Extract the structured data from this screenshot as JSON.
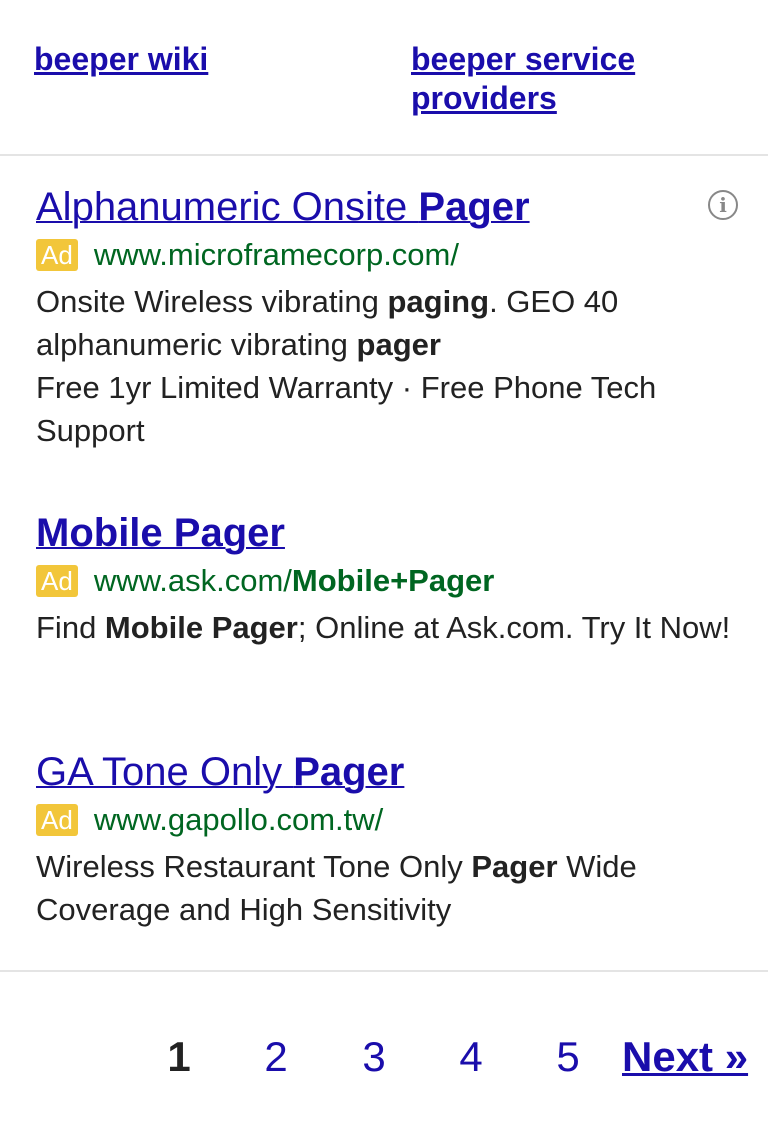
{
  "related_searches": [
    {
      "label": "beeper wiki"
    },
    {
      "label": "beeper service providers"
    }
  ],
  "ads": [
    {
      "title_pre": "Alphanumeric Onsite ",
      "title_bold": "Pager",
      "badge": "Ad",
      "url_pre": "www.microframecorp.com/",
      "url_bold": "",
      "desc1_a": "Onsite Wireless vibrating ",
      "desc1_b": "paging",
      "desc1_c": ". GEO 40 alphanumeric vibrating ",
      "desc1_d": "pager",
      "desc2": "Free 1yr Limited Warranty · Free Phone Tech Support"
    },
    {
      "title_pre": "",
      "title_bold": "Mobile Pager",
      "badge": "Ad",
      "url_pre": "www.ask.com/",
      "url_bold": "Mobile+Pager",
      "desc1_a": "Find ",
      "desc1_b": "Mobile Pager",
      "desc1_c": "; Online at Ask.com. Try It Now!",
      "desc1_d": ""
    },
    {
      "title_pre": "GA Tone Only ",
      "title_bold": "Pager",
      "badge": "Ad",
      "url_pre": "www.gapollo.com.tw/",
      "url_bold": "",
      "desc1_a": "Wireless Restaurant Tone Only ",
      "desc1_b": "Pager",
      "desc1_c": " Wide Coverage and High Sensitivity",
      "desc1_d": ""
    }
  ],
  "info_icon": "info-icon",
  "pagination": {
    "pages": [
      "1",
      "2",
      "3",
      "4",
      "5"
    ],
    "current": "1",
    "next_label": "Next »"
  },
  "colors": {
    "link": "#1a0dab",
    "url": "#006621",
    "badge": "#f2c63a",
    "text": "#222222"
  }
}
